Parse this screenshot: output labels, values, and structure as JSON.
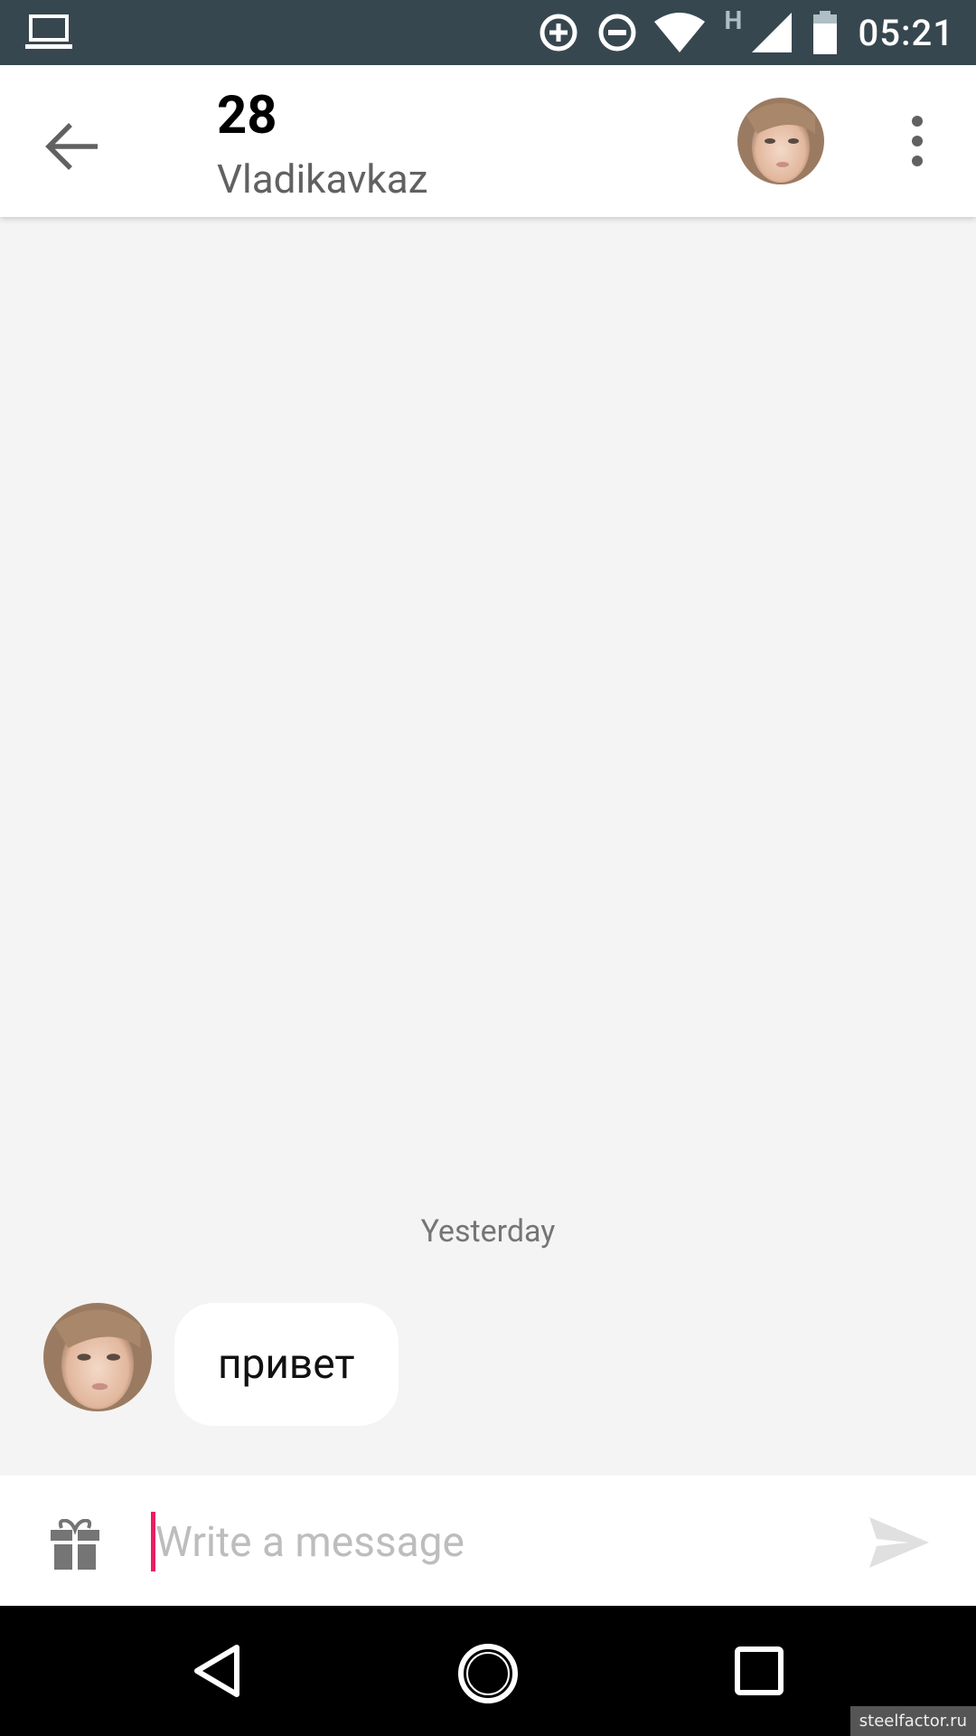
{
  "status_bar": {
    "time": "05:21",
    "icons": [
      "laptop-icon",
      "data-saver-icon",
      "do-not-disturb-icon",
      "wifi-icon",
      "h-network-icon",
      "signal-icon",
      "battery-icon"
    ],
    "network_letter": "H",
    "color": "#37474f"
  },
  "header": {
    "title": "28",
    "subtitle": "Vladikavkaz",
    "back_icon": "arrow-back-icon",
    "more_icon": "more-vertical-icon"
  },
  "chat": {
    "date_divider": "Yesterday",
    "messages": [
      {
        "text": "привет",
        "incoming": true
      }
    ]
  },
  "composer": {
    "placeholder": "Write a message",
    "value": "",
    "gift_icon": "gift-icon",
    "send_icon": "send-icon",
    "accent": "#e91e63"
  },
  "watermark": "steelfactor.ru"
}
